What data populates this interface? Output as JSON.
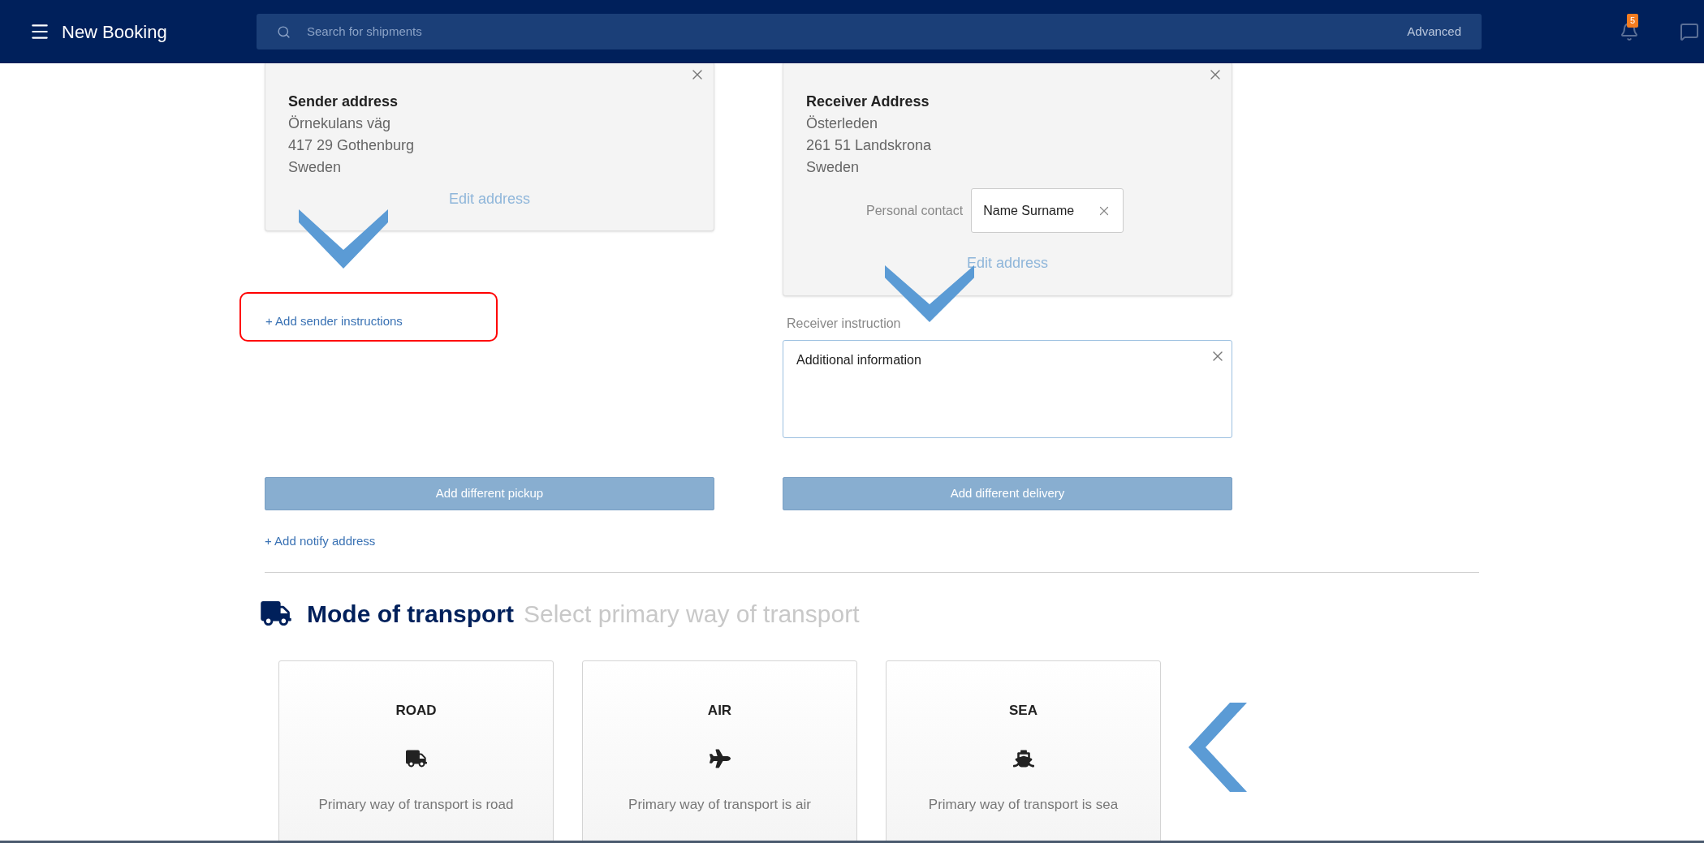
{
  "header": {
    "title": "New Booking",
    "search": {
      "placeholder": "Search for shipments",
      "advanced": "Advanced"
    },
    "notifications": {
      "count": "5"
    }
  },
  "sender": {
    "title": "Sender address",
    "lines": [
      "Örnekulans väg",
      "417 29 Gothenburg",
      "Sweden"
    ],
    "edit": "Edit address",
    "add_instructions": "+ Add sender instructions"
  },
  "receiver": {
    "title": "Receiver Address",
    "lines": [
      "Österleden",
      "261 51 Landskrona",
      "Sweden"
    ],
    "contact_label": "Personal contact",
    "contact_value": "Name Surname",
    "edit": "Edit address",
    "instruction_label": "Receiver instruction",
    "instruction_value": "Additional information"
  },
  "pickup_button": "Add different pickup",
  "delivery_button": "Add different delivery",
  "notify_link": "+ Add notify address",
  "transport": {
    "title": "Mode of transport",
    "subtitle": "Select primary way of transport",
    "modes": [
      {
        "kind": "road",
        "label": "ROAD",
        "description": "Primary way of transport is road",
        "selected": false
      },
      {
        "kind": "air",
        "label": "AIR",
        "description": "Primary way of transport is air",
        "selected": false
      },
      {
        "kind": "sea",
        "label": "SEA",
        "description": "Primary way of transport is sea",
        "selected": false
      }
    ]
  },
  "annotations": [
    {
      "kind": "chevron_down"
    },
    {
      "kind": "highlight"
    },
    {
      "kind": "chevron_down"
    },
    {
      "kind": "chevron_left"
    }
  ]
}
